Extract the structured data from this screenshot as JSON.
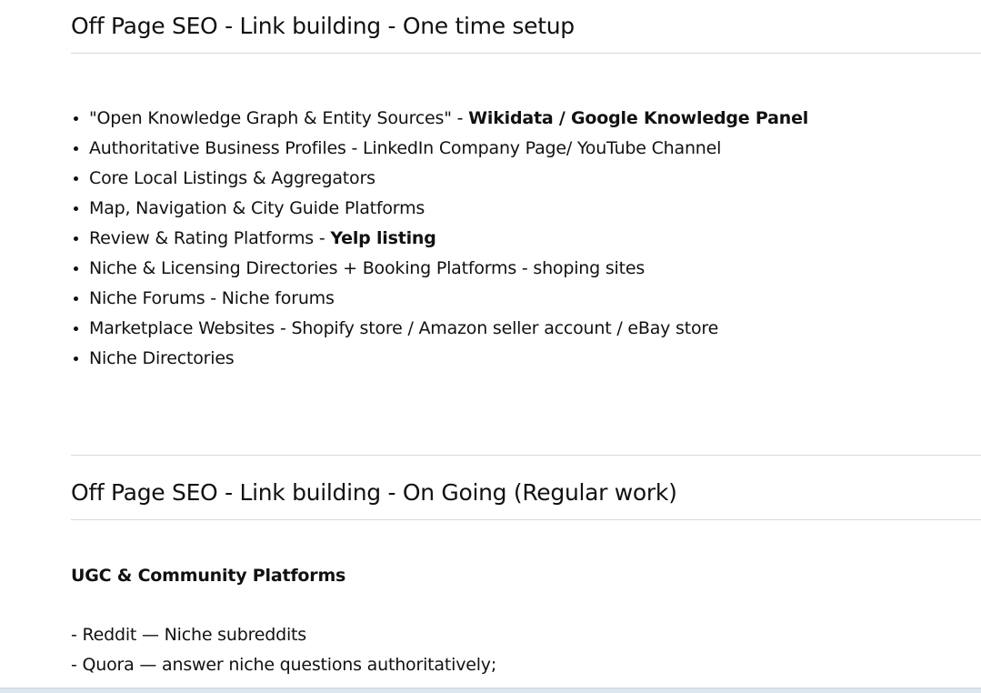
{
  "section1": {
    "title": "Off Page SEO - Link building - One time setup",
    "items": [
      {
        "text": "\"Open Knowledge Graph & Entity Sources\" - ",
        "bold": "Wikidata / Google Knowledge Panel"
      },
      {
        "text": "Authoritative Business Profiles - LinkedIn Company Page/ YouTube Channel",
        "bold": ""
      },
      {
        "text": "Core Local Listings & Aggregators",
        "bold": ""
      },
      {
        "text": "Map, Navigation & City Guide Platforms",
        "bold": ""
      },
      {
        "text": "Review & Rating Platforms - ",
        "bold": "Yelp listing"
      },
      {
        "text": "Niche & Licensing Directories + Booking Platforms - shoping sites",
        "bold": ""
      },
      {
        "text": "Niche Forums - Niche forums",
        "bold": ""
      },
      {
        "text": "Marketplace Websites - Shopify store / Amazon seller account / eBay store",
        "bold": ""
      },
      {
        "text": "Niche Directories",
        "bold": ""
      }
    ]
  },
  "section2": {
    "title": "Off Page SEO - Link building - On Going (Regular work)",
    "subheading": "UGC & Community Platforms",
    "lines": [
      "- Reddit — Niche subreddits",
      "- Quora — answer niche questions authoritatively;"
    ]
  }
}
